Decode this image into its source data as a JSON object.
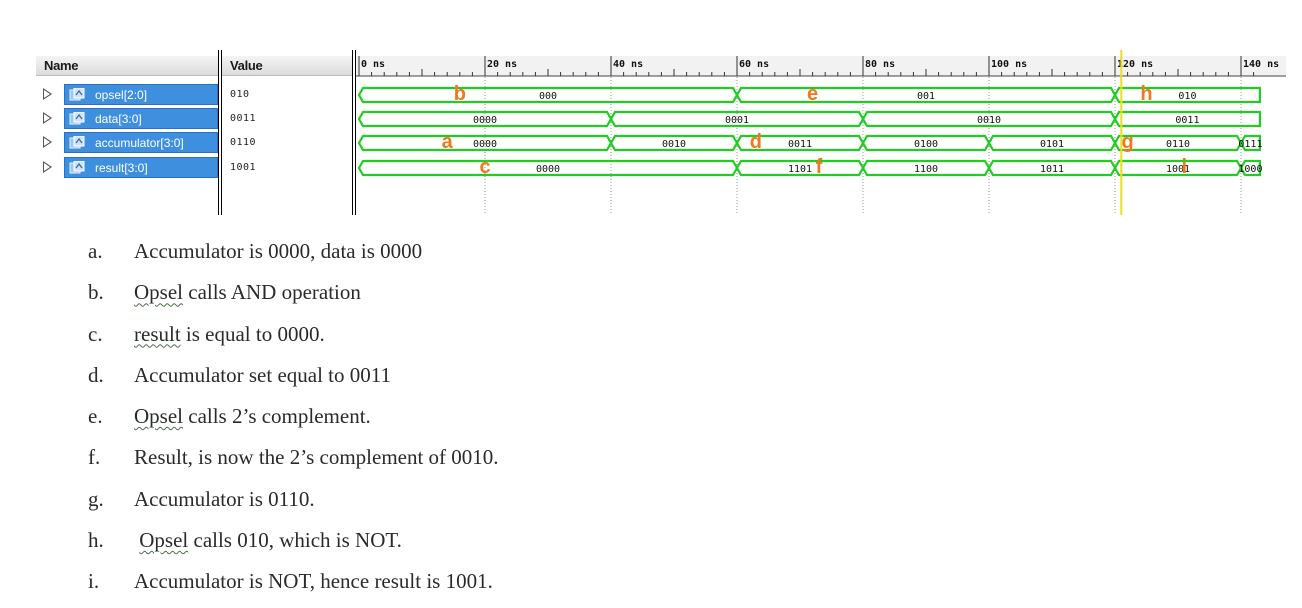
{
  "wave_viewer": {
    "name_header": "Name",
    "value_header": "Value",
    "signals": [
      {
        "name": "opsel[2:0]",
        "value": "010"
      },
      {
        "name": "data[3:0]",
        "value": "0011"
      },
      {
        "name": "accumulator[3:0]",
        "value": "0110"
      },
      {
        "name": "result[3:0]",
        "value": "1001"
      }
    ],
    "time_labels": [
      "0 ns",
      "20 ns",
      "40 ns",
      "60 ns",
      "80 ns",
      "100 ns",
      "120 ns",
      "140 ns"
    ],
    "cursor_time_ns": 121,
    "time_window_ns": [
      0,
      143
    ],
    "wave_segments": [
      [
        {
          "start": 0,
          "end": 60,
          "label": "000"
        },
        {
          "start": 60,
          "end": 120,
          "label": "001"
        },
        {
          "start": 120,
          "end": 143,
          "label": "010"
        }
      ],
      [
        {
          "start": 0,
          "end": 40,
          "label": "0000"
        },
        {
          "start": 40,
          "end": 80,
          "label": "0001"
        },
        {
          "start": 80,
          "end": 120,
          "label": "0010"
        },
        {
          "start": 120,
          "end": 143,
          "label": "0011"
        }
      ],
      [
        {
          "start": 0,
          "end": 40,
          "label": "0000"
        },
        {
          "start": 40,
          "end": 60,
          "label": "0010"
        },
        {
          "start": 60,
          "end": 80,
          "label": "0011"
        },
        {
          "start": 80,
          "end": 100,
          "label": "0100"
        },
        {
          "start": 100,
          "end": 120,
          "label": "0101"
        },
        {
          "start": 120,
          "end": 140,
          "label": "0110"
        },
        {
          "start": 140,
          "end": 143,
          "label": "0111"
        }
      ],
      [
        {
          "start": 0,
          "end": 60,
          "label": "0000"
        },
        {
          "start": 60,
          "end": 80,
          "label": "1101"
        },
        {
          "start": 80,
          "end": 100,
          "label": "1100"
        },
        {
          "start": 100,
          "end": 120,
          "label": "1011"
        },
        {
          "start": 120,
          "end": 140,
          "label": "1001"
        },
        {
          "start": 140,
          "end": 143,
          "label": "1000"
        }
      ]
    ],
    "markers": [
      {
        "letter": "b",
        "row": 0,
        "time_ns": 16
      },
      {
        "letter": "e",
        "row": 0,
        "time_ns": 72
      },
      {
        "letter": "h",
        "row": 0,
        "time_ns": 125
      },
      {
        "letter": "a",
        "row": 2,
        "time_ns": 14
      },
      {
        "letter": "d",
        "row": 2,
        "time_ns": 63
      },
      {
        "letter": "g",
        "row": 2,
        "time_ns": 122
      },
      {
        "letter": "c",
        "row": 3,
        "time_ns": 20
      },
      {
        "letter": "f",
        "row": 3,
        "time_ns": 73
      },
      {
        "letter": "i",
        "row": 3,
        "time_ns": 131
      }
    ],
    "colors": {
      "wave": "#22cc22",
      "marker": "#f07820",
      "cursor": "#e8e020",
      "selection": "#3f8fdf"
    }
  },
  "notes": [
    {
      "letter": "a.",
      "parts": [
        {
          "text": "Accumulator is 0000, data is 0000"
        }
      ]
    },
    {
      "letter": "b.",
      "parts": [
        {
          "text": "Opsel",
          "squiggle": true
        },
        {
          "text": " calls AND operation"
        }
      ]
    },
    {
      "letter": "c.",
      "parts": [
        {
          "text": "result",
          "squiggle": true
        },
        {
          "text": " is equal to 0000."
        }
      ]
    },
    {
      "letter": "d.",
      "parts": [
        {
          "text": "Accumulator set equal to 0011"
        }
      ]
    },
    {
      "letter": "e.",
      "parts": [
        {
          "text": "Opsel",
          "squiggle": true
        },
        {
          "text": " calls 2’s complement."
        }
      ]
    },
    {
      "letter": "f.",
      "parts": [
        {
          "text": "Result, is now the 2’s complement of 0010."
        }
      ]
    },
    {
      "letter": "g.",
      "parts": [
        {
          "text": "Accumulator is 0110."
        }
      ]
    },
    {
      "letter": "h.",
      "parts": [
        {
          "text": " "
        },
        {
          "text": "Opsel",
          "squiggle": true
        },
        {
          "text": " calls 010, which is NOT."
        }
      ]
    },
    {
      "letter": "i.",
      "parts": [
        {
          "text": "Accumulator is NOT, hence result is 1001."
        }
      ]
    }
  ]
}
